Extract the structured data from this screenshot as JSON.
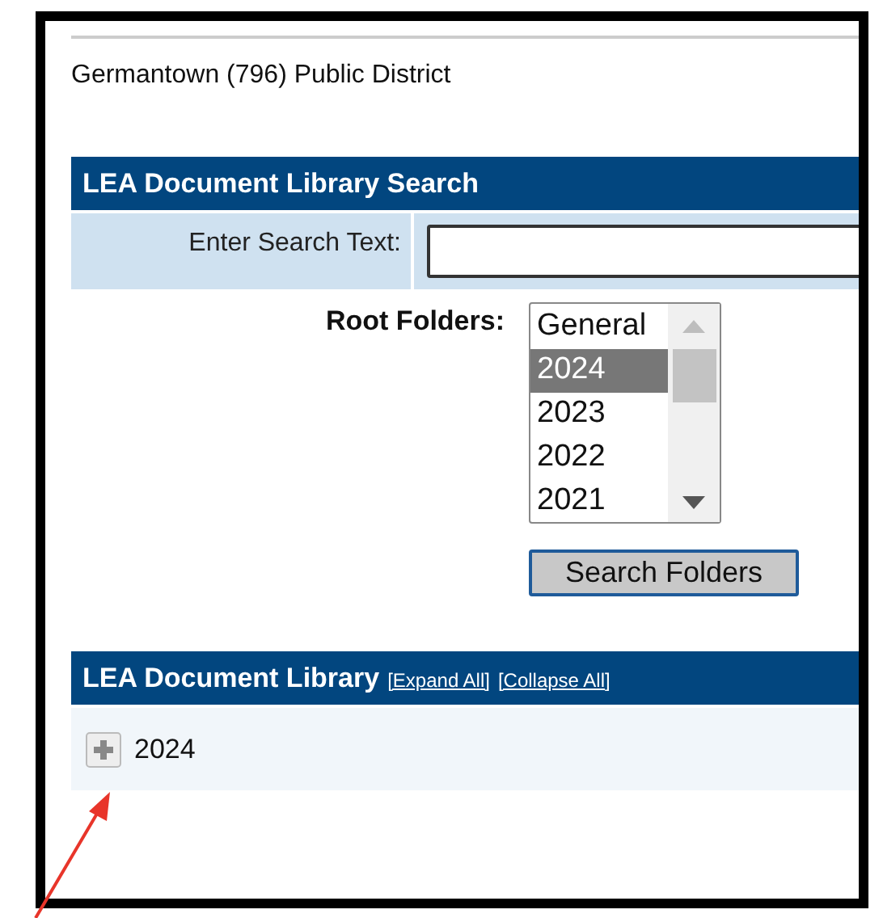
{
  "district_name": "Germantown (796) Public District",
  "search_panel": {
    "title": "LEA Document Library Search",
    "search_label": "Enter Search Text:",
    "root_folders_label": "Root Folders:",
    "root_folders": [
      {
        "label": "General",
        "selected": false
      },
      {
        "label": "2024",
        "selected": true
      },
      {
        "label": "2023",
        "selected": false
      },
      {
        "label": "2022",
        "selected": false
      },
      {
        "label": "2021",
        "selected": false
      }
    ],
    "button": "Search Folders"
  },
  "library_panel": {
    "title": "LEA Document Library",
    "links": [
      "[Expand All]",
      "[Collapse All]"
    ],
    "tree": [
      {
        "label": "2024",
        "expanded": false
      }
    ]
  }
}
